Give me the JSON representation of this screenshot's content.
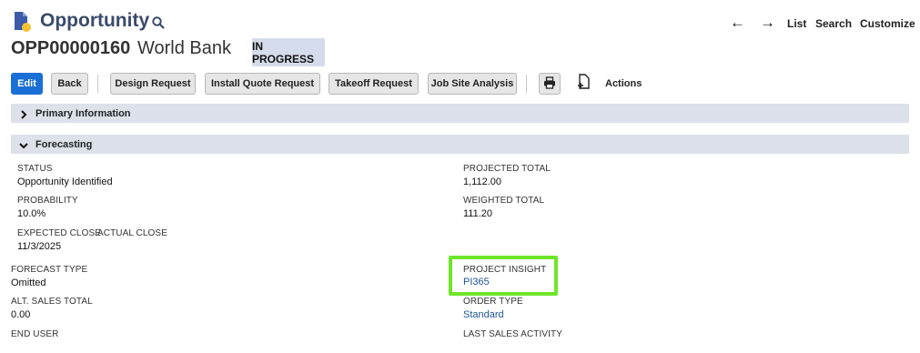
{
  "header": {
    "record_type": "Opportunity",
    "record_id": "OPP00000160",
    "record_name": "World Bank",
    "status": "IN PROGRESS",
    "nav": {
      "back_arrow": "←",
      "forward_arrow": "→",
      "list": "List",
      "search": "Search",
      "customize": "Customize"
    }
  },
  "toolbar": {
    "edit": "Edit",
    "back": "Back",
    "design_request": "Design Request",
    "install_quote_request": "Install Quote Request",
    "takeoff_request": "Takeoff Request",
    "job_site_analysis": "Job Site Analysis",
    "actions": "Actions"
  },
  "sections": {
    "primary": {
      "title": "Primary Information",
      "expanded": false
    },
    "forecasting": {
      "title": "Forecasting",
      "expanded": true
    }
  },
  "fields": {
    "status": {
      "label": "STATUS",
      "value": "Opportunity Identified"
    },
    "probability": {
      "label": "PROBABILITY",
      "value": "10.0%"
    },
    "expected_close": {
      "label": "EXPECTED CLOSE",
      "value": "11/3/2025"
    },
    "actual_close": {
      "label": "ACTUAL CLOSE",
      "value": ""
    },
    "projected_total": {
      "label": "PROJECTED TOTAL",
      "value": "1,112.00"
    },
    "weighted_total": {
      "label": "WEIGHTED TOTAL",
      "value": "111.20"
    },
    "forecast_type": {
      "label": "FORECAST TYPE",
      "value": "Omitted"
    },
    "alt_sales_total": {
      "label": "ALT. SALES TOTAL",
      "value": "0.00"
    },
    "end_user": {
      "label": "END USER",
      "value": ""
    },
    "project_insight": {
      "label": "PROJECT INSIGHT",
      "value": "PI365"
    },
    "order_type": {
      "label": "ORDER TYPE",
      "value": "Standard"
    },
    "last_sales_activity": {
      "label": "LAST SALES ACTIVITY",
      "value": ""
    }
  },
  "colors": {
    "primary_button": "#1a6fd6",
    "status_pill": "#d5dceb",
    "section_bar": "#dde1ea",
    "link": "#1f5499",
    "highlight": "#6ee629"
  }
}
